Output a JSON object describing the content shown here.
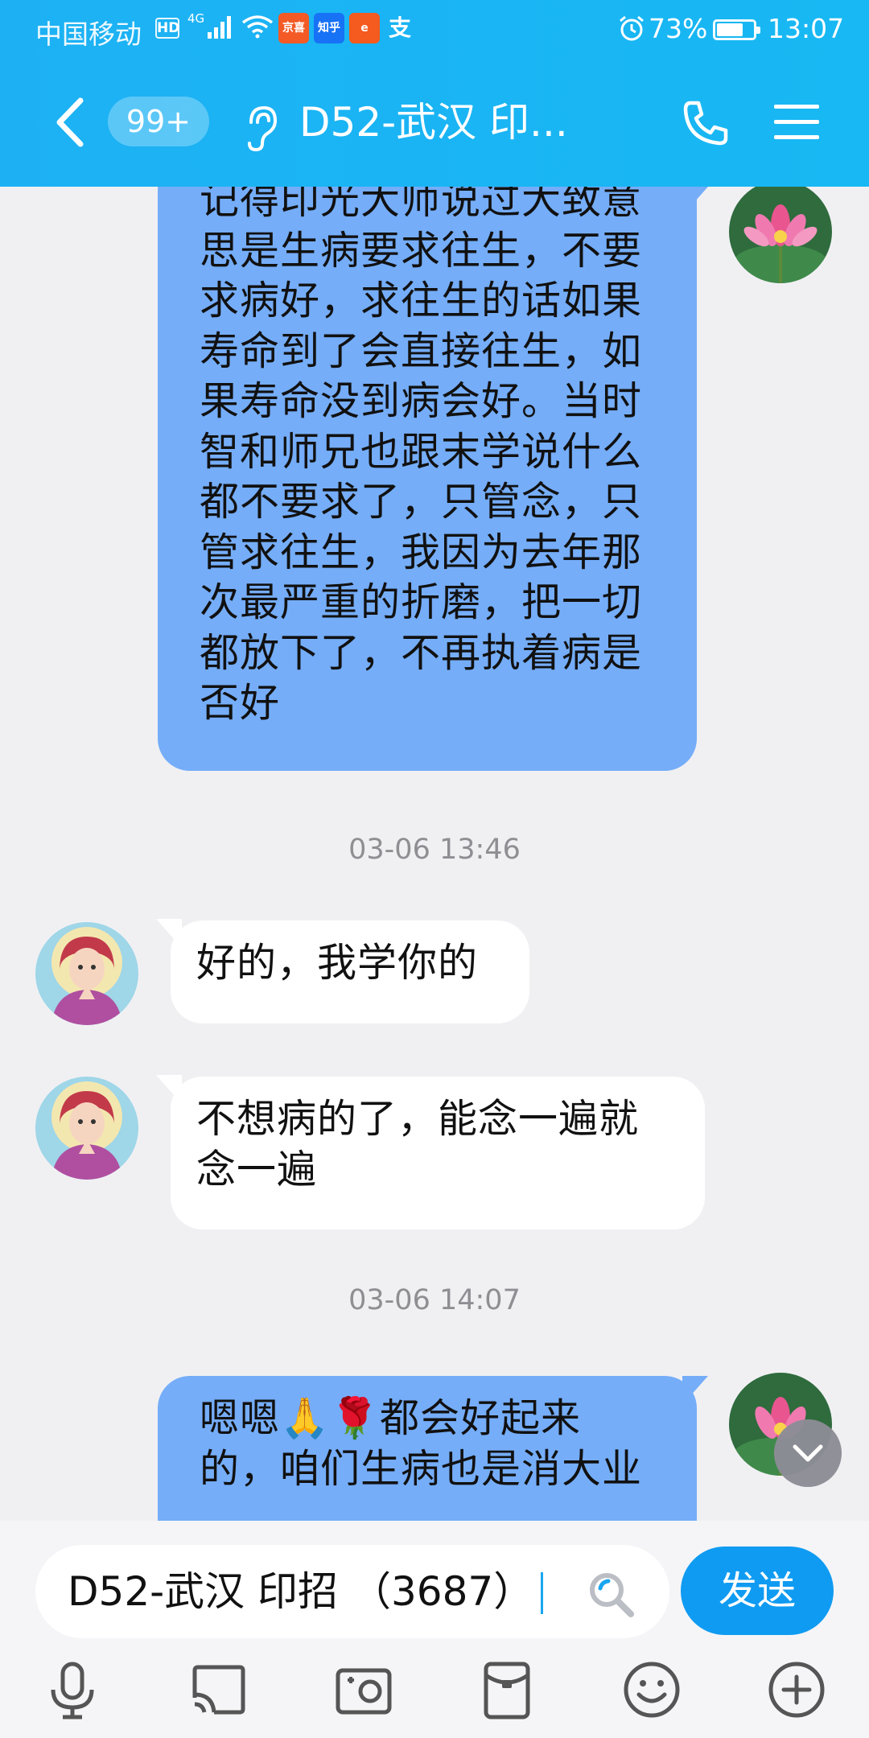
{
  "status_bar": {
    "carrier": "中国移动",
    "hd_label": "HD",
    "network": "4G",
    "apps": [
      {
        "icon": "jd-app-icon",
        "label": "京喜",
        "color": "#f35a25"
      },
      {
        "icon": "zhihu-app-icon",
        "label": "知乎",
        "color": "#1772f6"
      },
      {
        "icon": "alibaba-app-icon",
        "label": "e",
        "color": "#f55a1e"
      },
      {
        "icon": "alipay-app-icon",
        "label": "支",
        "color": "transparent"
      }
    ],
    "battery_percent": "73%",
    "battery_level": 0.73,
    "time": "13:07"
  },
  "header": {
    "badge": "99+",
    "title": "D52-武汉 印...",
    "accent_color": "#1db1f4"
  },
  "messages": [
    {
      "type": "sent",
      "lines": [
        "记得印光大师说过大致意",
        "思是生病要求往生，不要",
        "求病好，求往生的话如果",
        "寿命到了会直接往生，如",
        "果寿命没到病会好。当时",
        "智和师兄也跟末学说什么",
        "都不要求了，只管念，只",
        "管求往生，我因为去年那",
        "次最严重的折磨，把一切",
        "都放下了，不再执着病是",
        "否好"
      ]
    },
    {
      "type": "timestamp",
      "text": "03-06 13:46"
    },
    {
      "type": "received",
      "lines": [
        "好的，我学你的"
      ]
    },
    {
      "type": "received",
      "lines": [
        "不想病的了，能念一遍就",
        "念一遍"
      ]
    },
    {
      "type": "timestamp",
      "text": "03-06 14:07"
    },
    {
      "type": "sent",
      "lines": [
        "嗯嗯🙏🌹都会好起来",
        "的，咱们生病也是消大业"
      ]
    }
  ],
  "composer": {
    "input_value": "D52-武汉 印招 （3687）",
    "send_label": "发送"
  },
  "toolbar": [
    "microphone-icon",
    "screen-cast-icon",
    "photo-icon",
    "red-packet-icon",
    "emoji-icon",
    "plus-icon"
  ]
}
